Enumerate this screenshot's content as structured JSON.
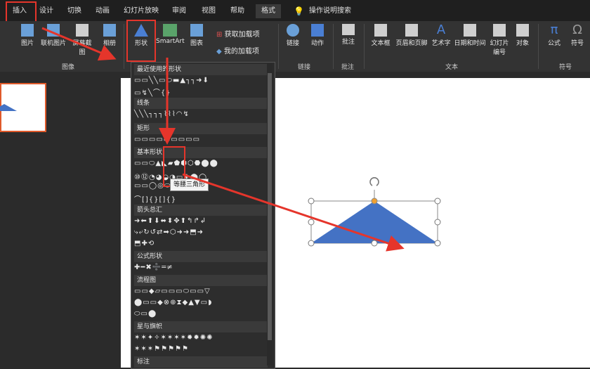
{
  "tabs": [
    "插入",
    "设计",
    "切换",
    "动画",
    "幻灯片放映",
    "审阅",
    "视图",
    "帮助",
    "格式"
  ],
  "search": {
    "label": "操作说明搜索"
  },
  "ribbon": {
    "images_group": {
      "items": [
        "图片",
        "联机图片",
        "屏幕截图",
        "相册"
      ],
      "label": "图像"
    },
    "shapes_button": "形状",
    "smartart": "SmartArt",
    "chart": "图表",
    "addins": {
      "get": "获取加载项",
      "mine": "我的加载项"
    },
    "links_group": {
      "items": [
        "链接",
        "动作"
      ],
      "label": "链接"
    },
    "comments_group": {
      "item": "批注",
      "label": "批注"
    },
    "text_group": {
      "items": [
        "文本框",
        "页眉和页脚",
        "艺术字",
        "日期和时间",
        "幻灯片编号",
        "对象"
      ],
      "label": "文本"
    },
    "symbols_group": {
      "items": [
        "公式",
        "符号"
      ],
      "label": "符号"
    }
  },
  "dropdown": {
    "sections": [
      {
        "title": "最近使用的形状",
        "rows": [
          "▭▭╲╲▭⬭▬▲┐┐➜⬇",
          "▭↯╲⌒{}"
        ]
      },
      {
        "title": "线条",
        "rows": [
          "╲╲╲┐┐┐⌇⌇⌇◠↯"
        ]
      },
      {
        "title": "矩形",
        "rows": [
          "▭▭▭▭▭▭▭▭▭"
        ]
      },
      {
        "title": "基本形状",
        "rows": [
          "▭▭⬭▲◣▰⬟⬢⬡⬣⬤⬤",
          "⑩⑫◔◕◒◑▭✚⬤◯",
          "▭▭◯◎⬭♥☀☾✿",
          "⌒[]{}[]{}"
        ]
      },
      {
        "title": "箭头总汇",
        "rows": [
          "➜⬅⬆⬇⬌⬍✥⬆↰↱↲",
          "⤷⤶↻↺⇄➡⬡➜➜⬒➜",
          "⬒✚⟲"
        ]
      },
      {
        "title": "公式形状",
        "rows": [
          "✚━✖➗═≠"
        ]
      },
      {
        "title": "流程图",
        "rows": [
          "▭▭◆▱▭▭▭⬭▭▭▽",
          "⬤▭▭◆⊗⊕⧗◆▲▼▭◗",
          "⬭▭⬤"
        ]
      },
      {
        "title": "星与旗帜",
        "rows": [
          "✶✶✦✧✶✶✶✶✹✹✺✺",
          "✶✶✶⚑⚑⚑⚑⚑"
        ]
      },
      {
        "title": "标注",
        "rows": []
      }
    ],
    "tooltip": "等腰三角形"
  }
}
